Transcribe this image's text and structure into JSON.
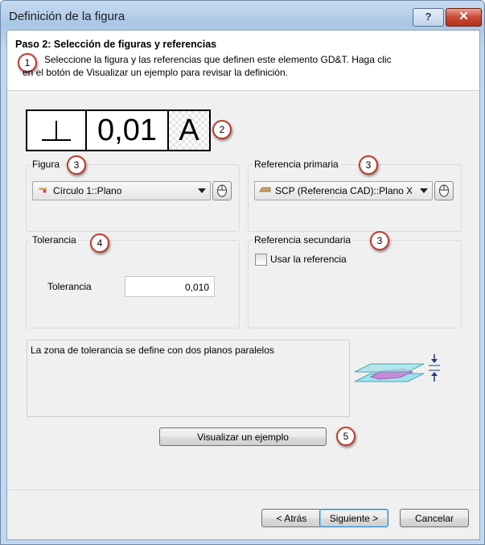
{
  "window": {
    "title": "Definición de la figura",
    "help_label": "?",
    "close_label": "✕"
  },
  "header": {
    "step_title": "Paso 2: Selección de figuras y referencias",
    "line1": "Seleccione la figura y las referencias que definen este elemento GD&T. Haga clic",
    "line2": "en el botón de Visualizar un ejemplo para revisar la definición."
  },
  "fcf": {
    "symbol": "perpendicularity",
    "tolerance": "0,01",
    "datum": "A"
  },
  "callouts": {
    "c1": "1",
    "c2": "2",
    "c3a": "3",
    "c3b": "3",
    "c3c": "3",
    "c4": "4",
    "c5": "5"
  },
  "figura": {
    "label": "Figura",
    "selected": "Círculo 1::Plano",
    "icon": "circle-feature-icon"
  },
  "referencia_primaria": {
    "label": "Referencia primaria",
    "selected": "SCP (Referencia CAD)::Plano X"
  },
  "tolerancia": {
    "group_label": "Tolerancia",
    "field_label": "Tolerancia",
    "value": "0,010"
  },
  "referencia_secundaria": {
    "label": "Referencia secundaria",
    "checkbox_label": "Usar la referencia",
    "checked": false
  },
  "description": "La zona de tolerancia se define con dos planos paralelos",
  "visualize_button": "Visualizar un ejemplo",
  "footer": {
    "back": "< Atrás",
    "next": "Siguiente >",
    "cancel": "Cancelar"
  },
  "colors": {
    "callout_border": "#c0392b",
    "plane_fill": "#9fe3ea",
    "zone_fill": "#c88ad8",
    "arrow": "#1f3d7a"
  }
}
